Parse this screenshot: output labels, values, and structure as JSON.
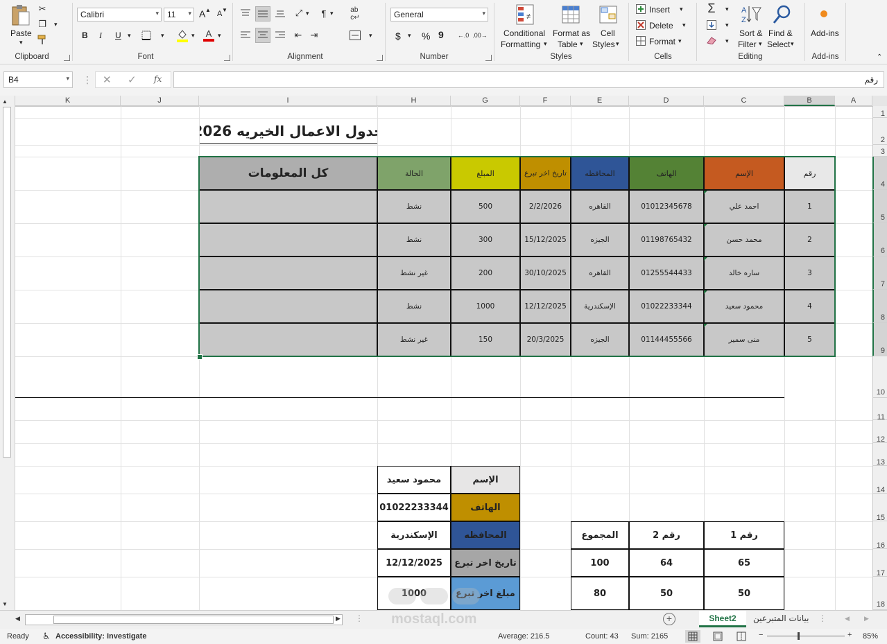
{
  "ribbon": {
    "clipboard": {
      "paste": "Paste",
      "label": "Clipboard"
    },
    "font": {
      "name": "Calibri",
      "size": "11",
      "label": "Font",
      "bold": "B",
      "italic": "I",
      "underline": "U",
      "grow": "A",
      "shrink": "A"
    },
    "alignment": {
      "label": "Alignment"
    },
    "number": {
      "format": "General",
      "currency": "$",
      "percent": "%",
      "comma": "9",
      "label": "Number"
    },
    "styles": {
      "conditional_1": "Conditional",
      "conditional_2": "Formatting",
      "format_table_1": "Format as",
      "format_table_2": "Table",
      "cell_styles_1": "Cell",
      "cell_styles_2": "Styles",
      "label": "Styles"
    },
    "cells": {
      "insert": "Insert",
      "delete": "Delete",
      "format": "Format",
      "label": "Cells"
    },
    "editing": {
      "sort_1": "Sort &",
      "sort_2": "Filter",
      "find_1": "Find &",
      "find_2": "Select",
      "label": "Editing"
    },
    "addins": {
      "button": "Add-ins",
      "label": "Add-ins"
    }
  },
  "formula_bar": {
    "name_box": "B4",
    "fx": "fx",
    "content": "رقم"
  },
  "columns": [
    {
      "id": "K",
      "label": "K"
    },
    {
      "id": "J",
      "label": "J"
    },
    {
      "id": "I",
      "label": "I"
    },
    {
      "id": "H",
      "label": "H"
    },
    {
      "id": "G",
      "label": "G"
    },
    {
      "id": "F",
      "label": "F"
    },
    {
      "id": "E",
      "label": "E"
    },
    {
      "id": "D",
      "label": "D"
    },
    {
      "id": "C",
      "label": "C"
    },
    {
      "id": "B",
      "label": "B"
    },
    {
      "id": "A",
      "label": "A"
    }
  ],
  "rows": [
    "1",
    "2",
    "3",
    "4",
    "5",
    "6",
    "7",
    "8",
    "9",
    "10",
    "11",
    "12",
    "13",
    "14",
    "15",
    "16",
    "17",
    "18"
  ],
  "sheet": {
    "title": "جدول الاعمال الخيريه 2026",
    "headers": {
      "num": "رقم",
      "name": "الإسم",
      "phone": "الهاتف",
      "gov": "المحافظه",
      "date": "تاريخ اخر تبرع",
      "amount": "المبلغ",
      "status": "الحالة",
      "all_info": "كل المعلومات"
    },
    "header_colors": {
      "num": "#e8e8e8",
      "name": "#c55a20",
      "phone": "#548235",
      "gov": "#2f5597",
      "date": "#bf8f00",
      "amount": "#c9c900",
      "status": "#7fa36a",
      "all_info": "#aeaeae"
    },
    "records": [
      {
        "num": "1",
        "name": "احمد علي",
        "phone": "01012345678",
        "gov": "القاهره",
        "date": "2/2/2026",
        "amount": "500",
        "status": "نشط"
      },
      {
        "num": "2",
        "name": "محمد حسن",
        "phone": "01198765432",
        "gov": "الجيزه",
        "date": "15/12/2025",
        "amount": "300",
        "status": "نشط"
      },
      {
        "num": "3",
        "name": "ساره خالد",
        "phone": "01255544433",
        "gov": "القاهره",
        "date": "30/10/2025",
        "amount": "200",
        "status": "غير نشط"
      },
      {
        "num": "4",
        "name": "محمود سعيد",
        "phone": "01022233344",
        "gov": "الإسكندرية",
        "date": "12/12/2025",
        "amount": "1000",
        "status": "نشط"
      },
      {
        "num": "5",
        "name": "منى سمير",
        "phone": "01144455566",
        "gov": "الجيزه",
        "date": "20/3/2025",
        "amount": "150",
        "status": "غير نشط"
      }
    ],
    "lookup": {
      "labels": [
        "الإسم",
        "الهاتف",
        "المحافظه",
        "تاريخ اخر تبرع",
        "مبلغ اخر تبرع"
      ],
      "label_colors": [
        "#e7e6e6",
        "#bf8f00",
        "#2f5597",
        "#a6a6a6",
        "#5b9bd5"
      ],
      "values": [
        "محمود سعيد",
        "01022233344",
        "الإسكندرية",
        "12/12/2025",
        "1000"
      ]
    },
    "sum_table": {
      "headers": [
        "رقم 1",
        "رقم 2",
        "المجموع"
      ],
      "rows": [
        [
          "65",
          "64",
          "100"
        ],
        [
          "50",
          "50",
          "80"
        ]
      ]
    }
  },
  "tabs": {
    "active": "Sheet2",
    "other": "بيانات المتبرعين",
    "add": "+"
  },
  "status": {
    "ready": "Ready",
    "accessibility": "Accessibility: Investigate",
    "average": "Average: 216.5",
    "count": "Count: 43",
    "sum": "Sum: 2165",
    "zoom": "85%",
    "minus": "−",
    "plus": "+"
  },
  "watermark": "mostaql.com"
}
